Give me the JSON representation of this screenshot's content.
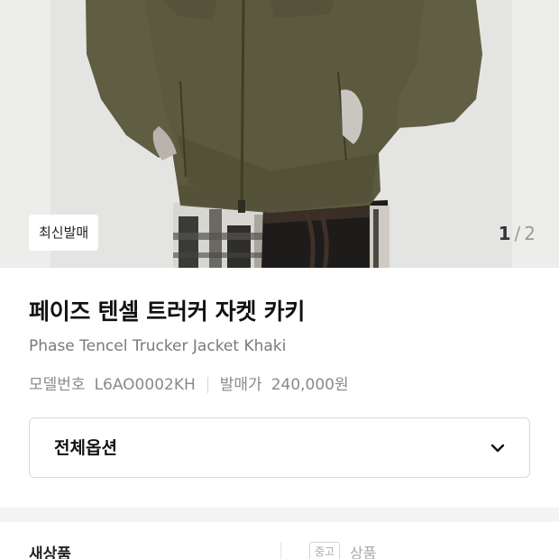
{
  "hero": {
    "badge": "최신발매",
    "pager": {
      "current": "1",
      "separator": "/",
      "total": "2"
    }
  },
  "product": {
    "title_ko": "페이즈 텐셀 트러커 자켓 카키",
    "title_en": "Phase Tencel Trucker Jacket Khaki",
    "model_label": "모델번호",
    "model_value": "L6AO0002KH",
    "price_label": "발매가",
    "price_value": "240,000원"
  },
  "options": {
    "label": "전체옵션",
    "icon": "chevron-down-icon"
  },
  "condition": {
    "new_label": "새상품",
    "used_tag": "중고",
    "used_label": "상품"
  }
}
